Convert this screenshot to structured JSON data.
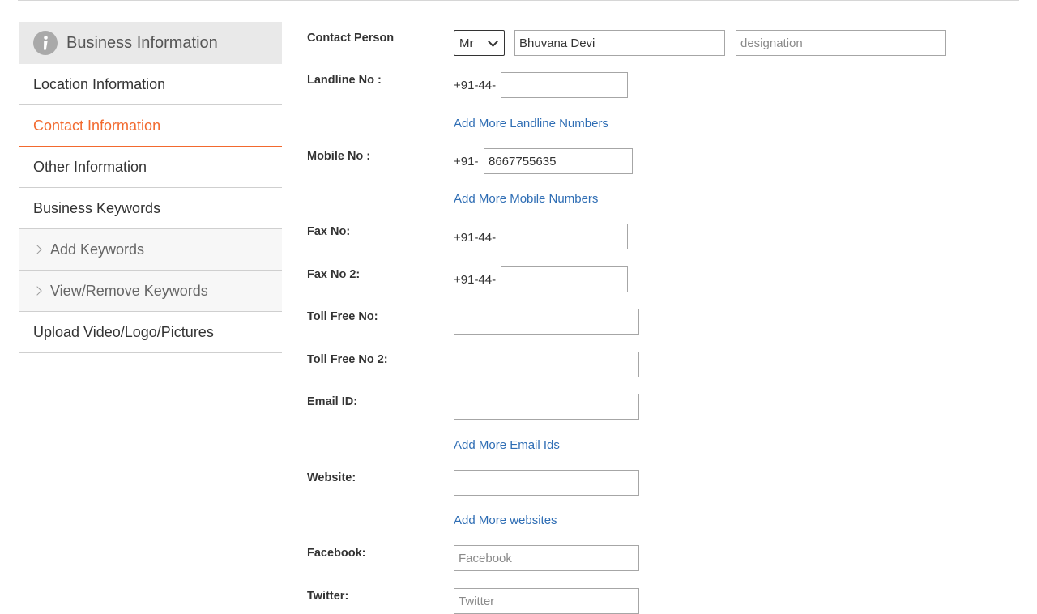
{
  "sidebar": {
    "title": "Business Information",
    "items": [
      {
        "label": "Location Information"
      },
      {
        "label": "Contact Information"
      },
      {
        "label": "Other Information"
      },
      {
        "label": "Business Keywords"
      },
      {
        "label": "Add Keywords"
      },
      {
        "label": "View/Remove Keywords"
      },
      {
        "label": "Upload Video/Logo/Pictures"
      }
    ],
    "colors": {
      "active": "#f2692e",
      "header_bg": "#e9e9e9"
    }
  },
  "form": {
    "contact_person": {
      "label": "Contact Person",
      "title_value": "Mr",
      "name_value": "Bhuvana Devi",
      "designation_placeholder": "designation"
    },
    "landline": {
      "label": "Landline No :",
      "prefix": "+91-44-",
      "value": "",
      "add_more": "Add More Landline Numbers"
    },
    "mobile": {
      "label": "Mobile No :",
      "prefix": "+91-",
      "value": "8667755635",
      "add_more": "Add More Mobile Numbers"
    },
    "fax": {
      "label": "Fax No:",
      "prefix": "+91-44-",
      "value": ""
    },
    "fax2": {
      "label": "Fax No 2:",
      "prefix": "+91-44-",
      "value": ""
    },
    "tollfree": {
      "label": "Toll Free No:",
      "value": ""
    },
    "tollfree2": {
      "label": "Toll Free No 2:",
      "value": ""
    },
    "email": {
      "label": "Email ID:",
      "value": "",
      "add_more": "Add More Email Ids"
    },
    "website": {
      "label": "Website:",
      "value": "",
      "add_more": "Add More websites"
    },
    "facebook": {
      "label": "Facebook:",
      "placeholder": "Facebook"
    },
    "twitter": {
      "label": "Twitter:",
      "placeholder": "Twitter"
    },
    "link_color": "#2e6db4"
  }
}
